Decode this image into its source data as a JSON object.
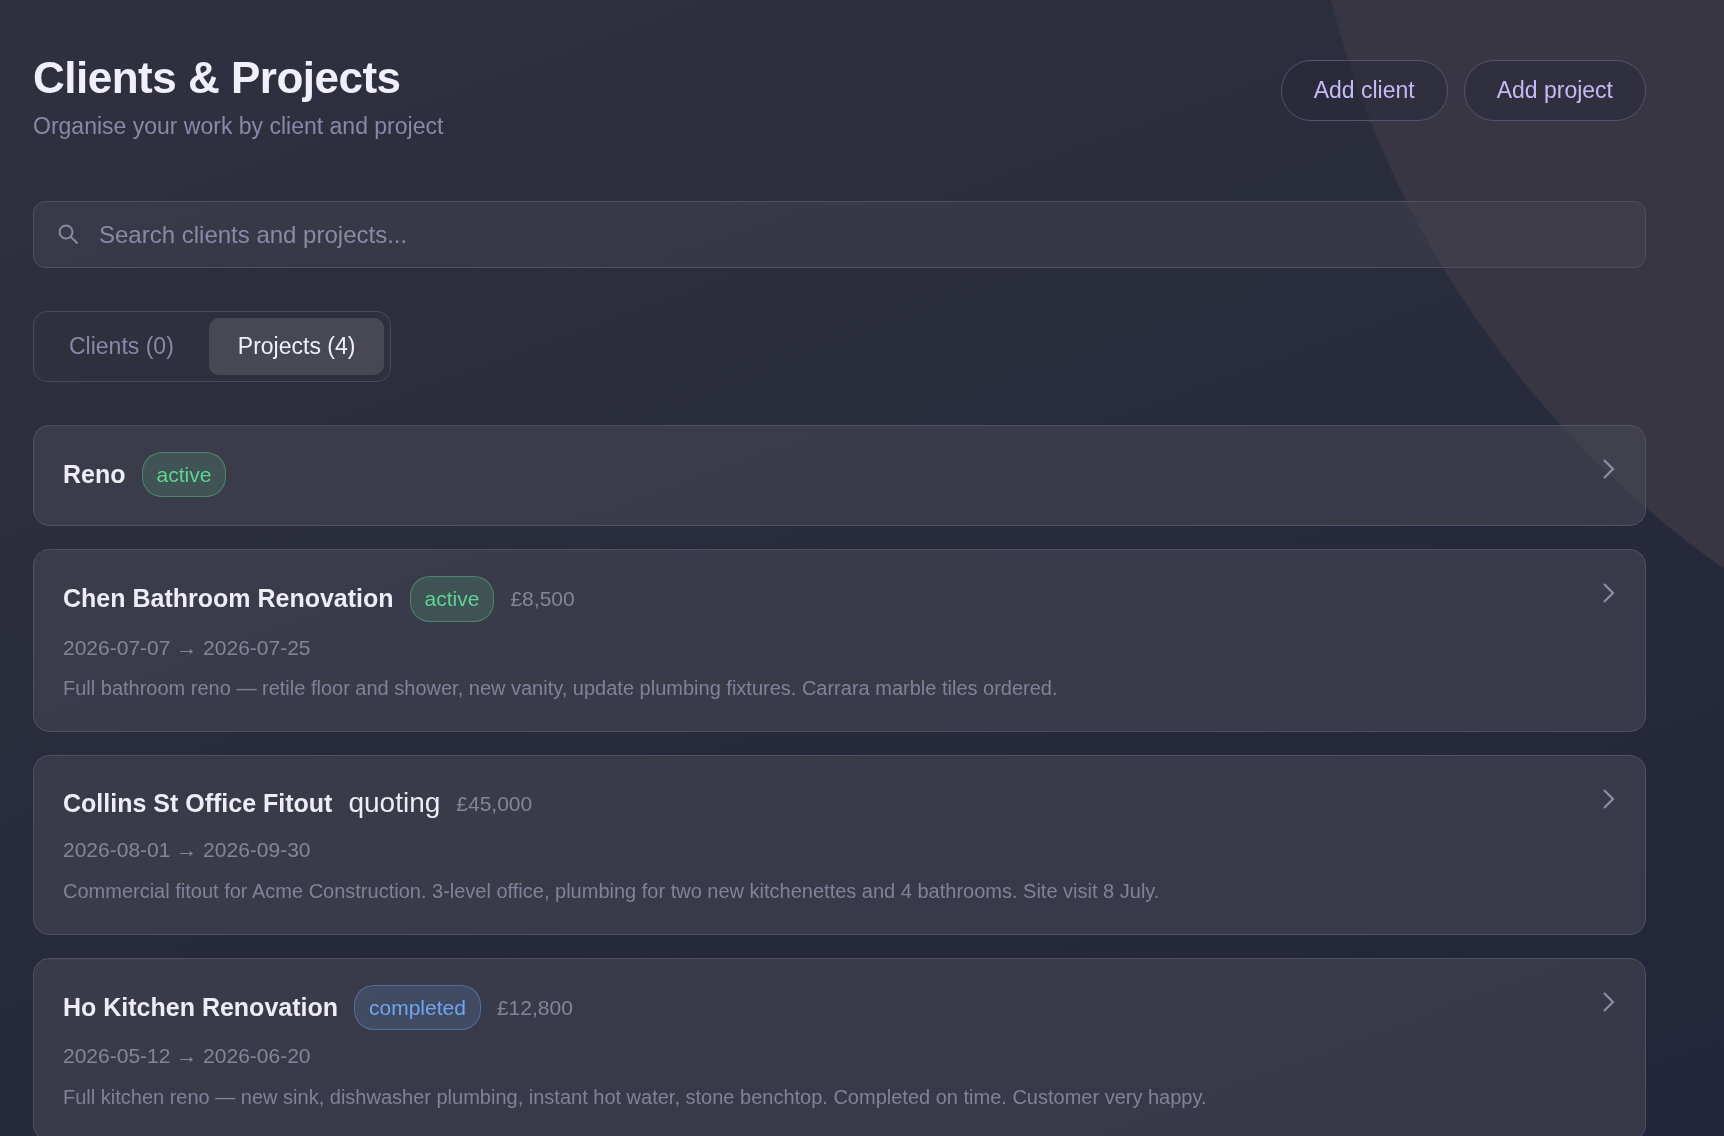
{
  "header": {
    "title": "Clients & Projects",
    "subtitle": "Organise your work by client and project"
  },
  "buttons": [
    "Add client",
    "Add project"
  ],
  "search": {
    "placeholder": "Search clients and projects..."
  },
  "tabs": [
    {
      "label": "Clients (0)",
      "selected": false
    },
    {
      "label": "Projects (4)",
      "selected": true
    }
  ],
  "projects": [
    {
      "name": "Reno",
      "status": "active",
      "kind": "badge",
      "color": "#5fd495"
    },
    {
      "name": "Chen Bathroom Renovation",
      "status": "active",
      "kind": "badge",
      "color": "#5fd495",
      "amount": "£8,500",
      "dates": "2026-07-07 → 2026-07-25",
      "description": "Full bathroom reno — retile floor and shower, new vanity, update plumbing fixtures. Carrara marble tiles ordered."
    },
    {
      "name": "Collins St Office Fitout",
      "status": "quoting",
      "kind": "text",
      "amount": "£45,000",
      "dates": "2026-08-01 → 2026-09-30",
      "description": "Commercial fitout for Acme Construction. 3-level office, plumbing for two new kitchenettes and 4 bathrooms. Site visit 8 July."
    },
    {
      "name": "Ho Kitchen Renovation",
      "status": "completed",
      "kind": "badge",
      "color": "#6fa6f0",
      "amount": "£12,800",
      "dates": "2026-05-12 → 2026-06-20",
      "description": "Full kitchen reno — new sink, dishwasher plumbing, instant hot water, stone benchtop. Completed on time. Customer very happy."
    }
  ]
}
